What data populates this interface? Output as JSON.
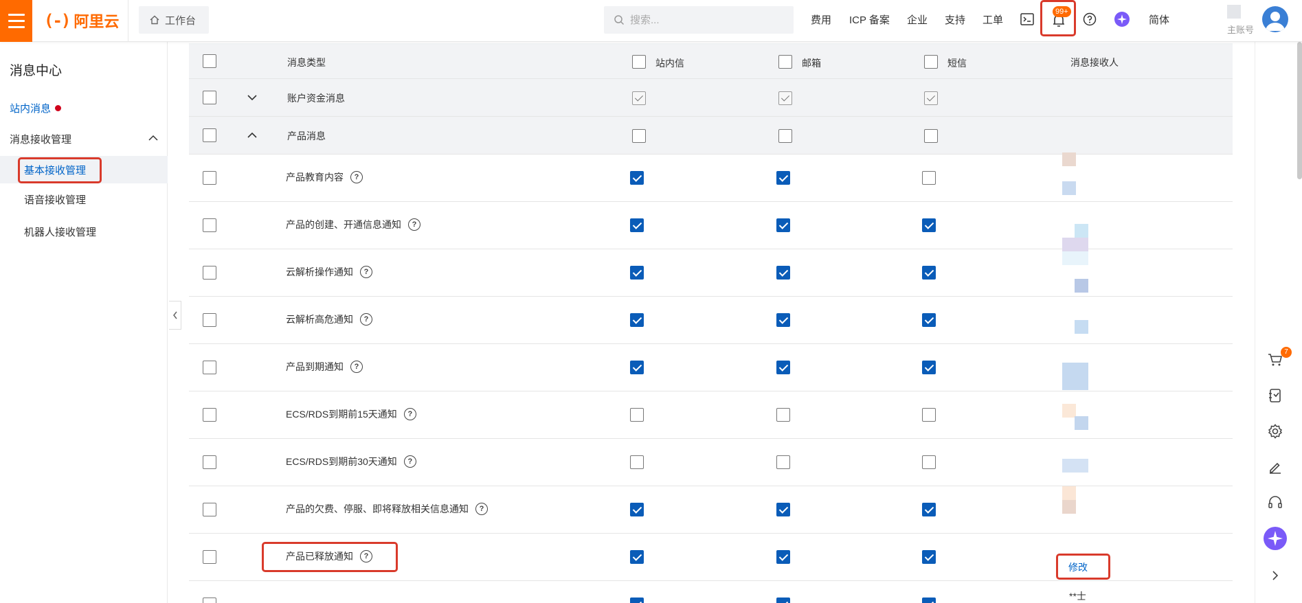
{
  "header": {
    "logo_mark": "(-)",
    "logo_text": "阿里云",
    "workbench_label": "工作台",
    "search_placeholder": "搜索...",
    "nav": [
      "费用",
      "ICP 备案",
      "企业",
      "支持",
      "工单"
    ],
    "bell_badge": "99+",
    "lang_label": "简体",
    "account_label": "主账号",
    "accent": "#ff6a00"
  },
  "sidebar": {
    "title": "消息中心",
    "inbox_label": "站内消息",
    "group_label": "消息接收管理",
    "items": [
      "基本接收管理",
      "语音接收管理",
      "机器人接收管理"
    ]
  },
  "table": {
    "headers": {
      "type": "消息类型",
      "inbox": "站内信",
      "email": "邮箱",
      "sms": "短信",
      "recipient": "消息接收人"
    },
    "groups": [
      {
        "label": "账户资金消息",
        "expanded": false,
        "inbox": true,
        "email": true,
        "sms": true
      },
      {
        "label": "产品消息",
        "expanded": true,
        "inbox": false,
        "email": false,
        "sms": false
      }
    ],
    "rows": [
      {
        "label": "产品教育内容",
        "inbox": true,
        "email": true,
        "sms": false
      },
      {
        "label": "产品的创建、开通信息通知",
        "inbox": true,
        "email": true,
        "sms": true
      },
      {
        "label": "云解析操作通知",
        "inbox": true,
        "email": true,
        "sms": true
      },
      {
        "label": "云解析高危通知",
        "inbox": true,
        "email": true,
        "sms": true
      },
      {
        "label": "产品到期通知",
        "inbox": true,
        "email": true,
        "sms": true
      },
      {
        "label": "ECS/RDS到期前15天通知",
        "inbox": false,
        "email": false,
        "sms": false
      },
      {
        "label": "ECS/RDS到期前30天通知",
        "inbox": false,
        "email": false,
        "sms": false
      },
      {
        "label": "产品的欠费、停服、即将释放相关信息通知",
        "inbox": true,
        "email": true,
        "sms": true
      },
      {
        "label": "产品已释放通知",
        "inbox": true,
        "email": true,
        "sms": true
      }
    ],
    "edit_label": "修改",
    "masked_recipient": "**士"
  },
  "rail": {
    "cart_badge": "7"
  },
  "colors": {
    "checkbox_checked": "#0a5cb8",
    "link": "#0064c8",
    "highlight_box": "#d93a2b"
  }
}
